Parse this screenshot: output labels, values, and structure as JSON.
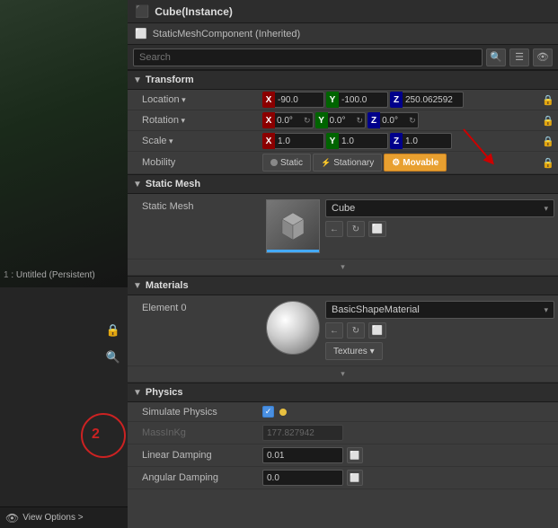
{
  "titleBar": {
    "icon": "cube-icon",
    "title": "Cube(Instance)"
  },
  "breadcrumb": {
    "icon": "static-mesh-icon",
    "text": "StaticMeshComponent (Inherited)"
  },
  "search": {
    "placeholder": "Search",
    "value": ""
  },
  "sections": {
    "transform": {
      "label": "Transform",
      "location": {
        "label": "Location",
        "x": "-90.0",
        "y": "-100.0",
        "z": "250.062592"
      },
      "rotation": {
        "label": "Rotation",
        "x": "0.0°",
        "y": "0.0°",
        "z": "0.0°"
      },
      "scale": {
        "label": "Scale",
        "x": "1.0",
        "y": "1.0",
        "z": "1.0"
      },
      "mobility": {
        "label": "Mobility",
        "options": [
          "Static",
          "Stationary",
          "Movable"
        ],
        "active": "Movable"
      }
    },
    "staticMesh": {
      "label": "Static Mesh",
      "property": "Static Mesh",
      "value": "Cube",
      "actions": [
        "back-icon",
        "reload-icon",
        "browse-icon"
      ]
    },
    "materials": {
      "label": "Materials",
      "element0": {
        "label": "Element 0",
        "value": "BasicShapeMaterial",
        "actions": [
          "back-icon",
          "reload-icon",
          "browse-icon"
        ],
        "texturesBtn": "Textures ▾"
      }
    },
    "physics": {
      "label": "Physics",
      "simulatePhysics": {
        "label": "Simulate Physics",
        "checked": true
      },
      "massInKg": {
        "label": "MassInKg",
        "value": "177.827942",
        "disabled": true
      },
      "linearDamping": {
        "label": "Linear Damping",
        "value": "0.01"
      },
      "angularDamping": {
        "label": "Angular Damping",
        "value": "0.0"
      }
    }
  },
  "viewOptions": {
    "label": "View Options >"
  },
  "annotations": {
    "number1": "1",
    "number2": "2"
  }
}
